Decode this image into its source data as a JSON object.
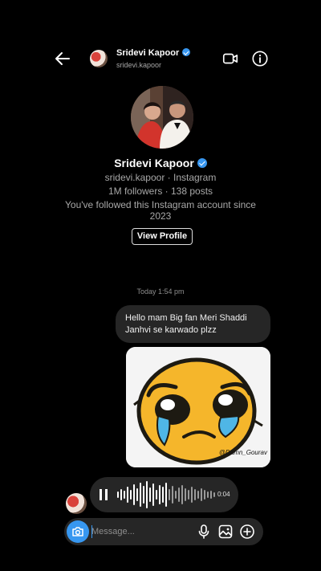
{
  "header": {
    "name": "Sridevi Kapoor",
    "username": "sridevi.kapoor",
    "icons": [
      "arrow-left-icon",
      "verified-icon",
      "video-camera-icon",
      "info-icon"
    ]
  },
  "profile": {
    "name": "Sridevi Kapoor",
    "subtitle": "sridevi.kapoor · Instagram",
    "stats": "1M followers · 138 posts",
    "followed_line1": "You've followed this Instagram account since",
    "followed_line2": "2023",
    "view_profile_label": "View Profile"
  },
  "chat": {
    "timestamp": "Today 1:54 pm",
    "messages": [
      {
        "type": "text",
        "line1": "Hello mam Big fan Meri Shaddi",
        "line2": "Janhvi se karwado plzz"
      },
      {
        "type": "sticker",
        "description": "crying-emoji-sticker",
        "watermark": "@Damn_Gourav"
      },
      {
        "type": "voice",
        "duration": "0:04"
      }
    ]
  },
  "composer": {
    "placeholder": "Message...",
    "icons": [
      "camera-icon",
      "microphone-icon",
      "gallery-icon",
      "plus-icon"
    ]
  },
  "colors": {
    "background": "#000000",
    "bubble": "#262626",
    "accent": "#3797f0",
    "muted_text": "#a8a8a8"
  }
}
